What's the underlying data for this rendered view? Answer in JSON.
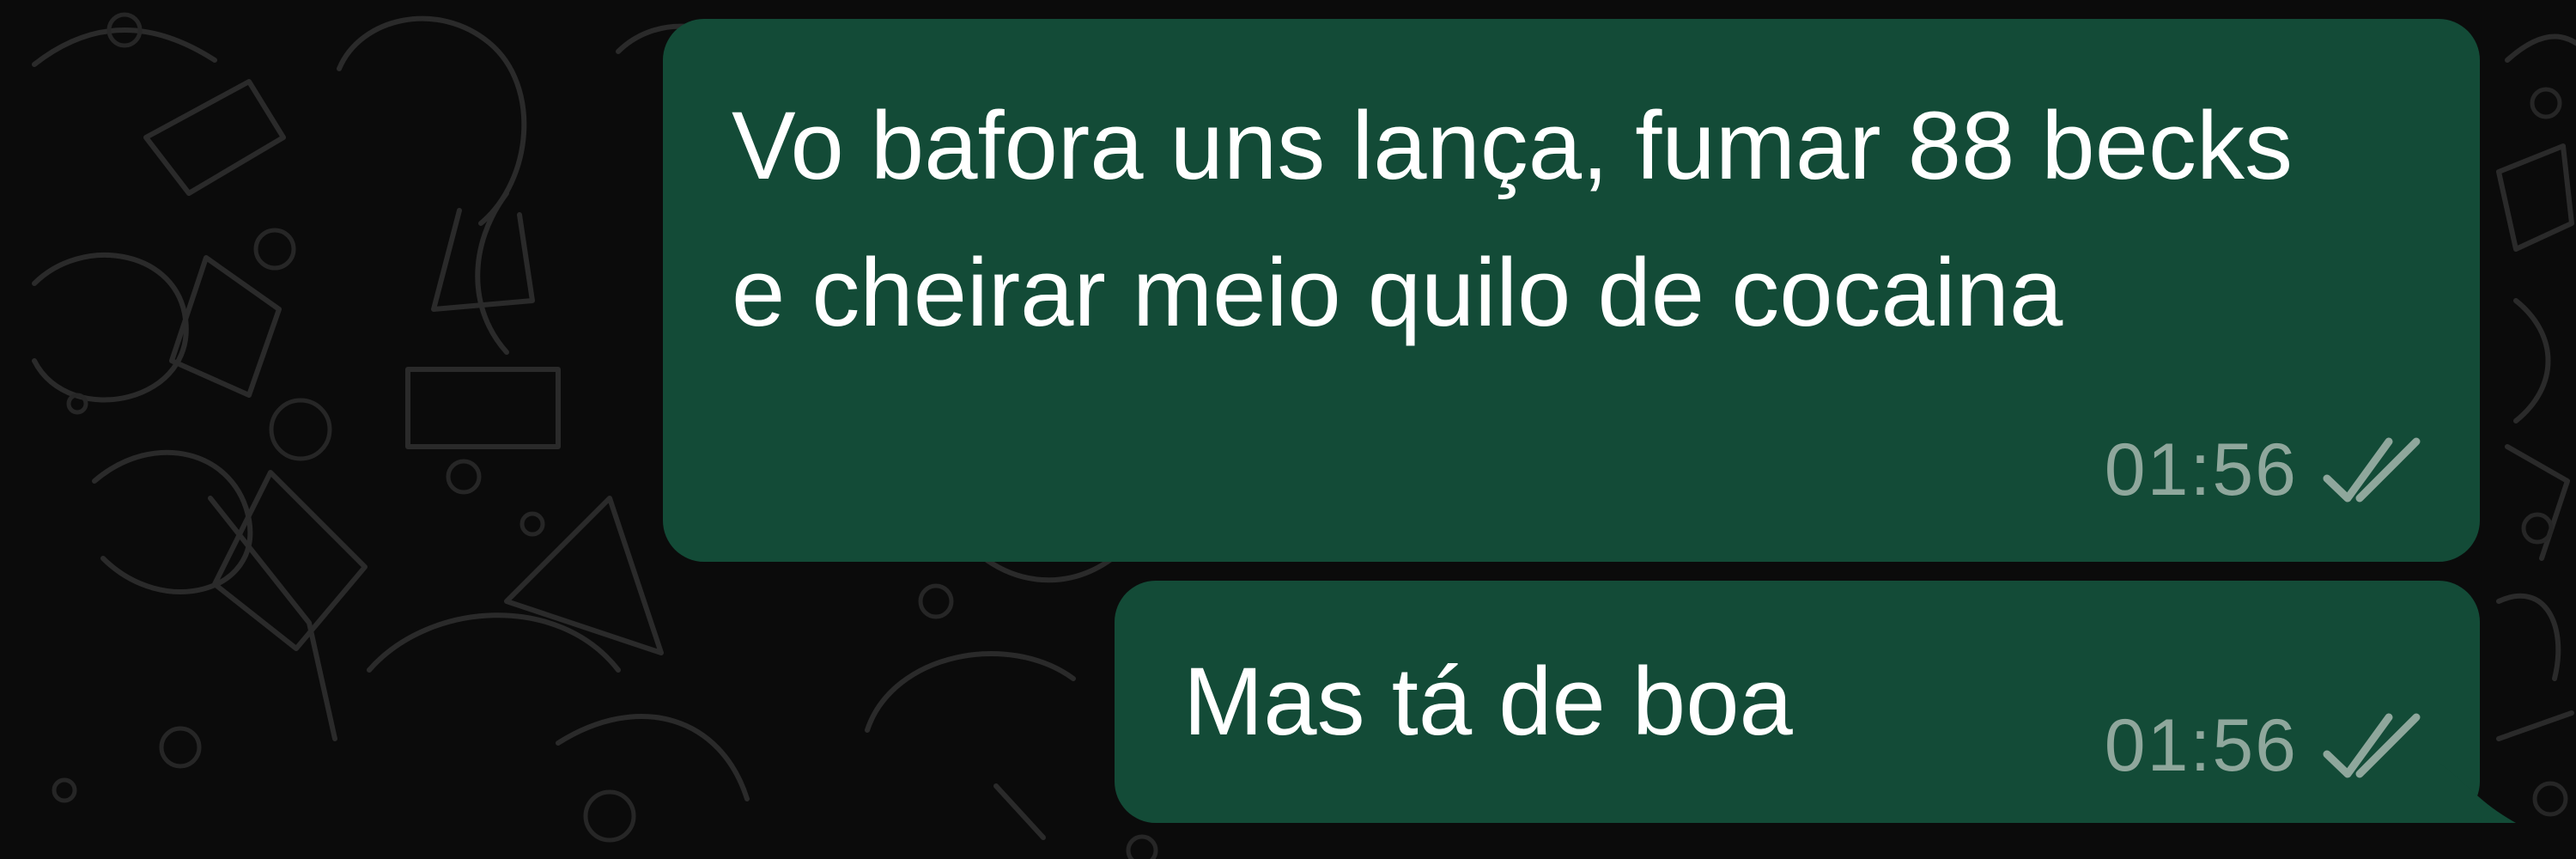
{
  "chat": {
    "messages": [
      {
        "text": "Vo bafora uns lança, fumar 88 becks e cheirar meio quilo de cocaina",
        "time": "01:56",
        "status_icon": "double-check-icon"
      },
      {
        "text": "Mas tá de boa",
        "time": "01:56",
        "status_icon": "double-check-icon"
      }
    ]
  },
  "theme": {
    "background_color": "#0b0b0b",
    "outgoing_bubble_color": "#134b37",
    "message_text_color": "#ffffff",
    "meta_text_color": "#8fa79c",
    "wallpaper_doodle_color": "#2a2a2a"
  }
}
